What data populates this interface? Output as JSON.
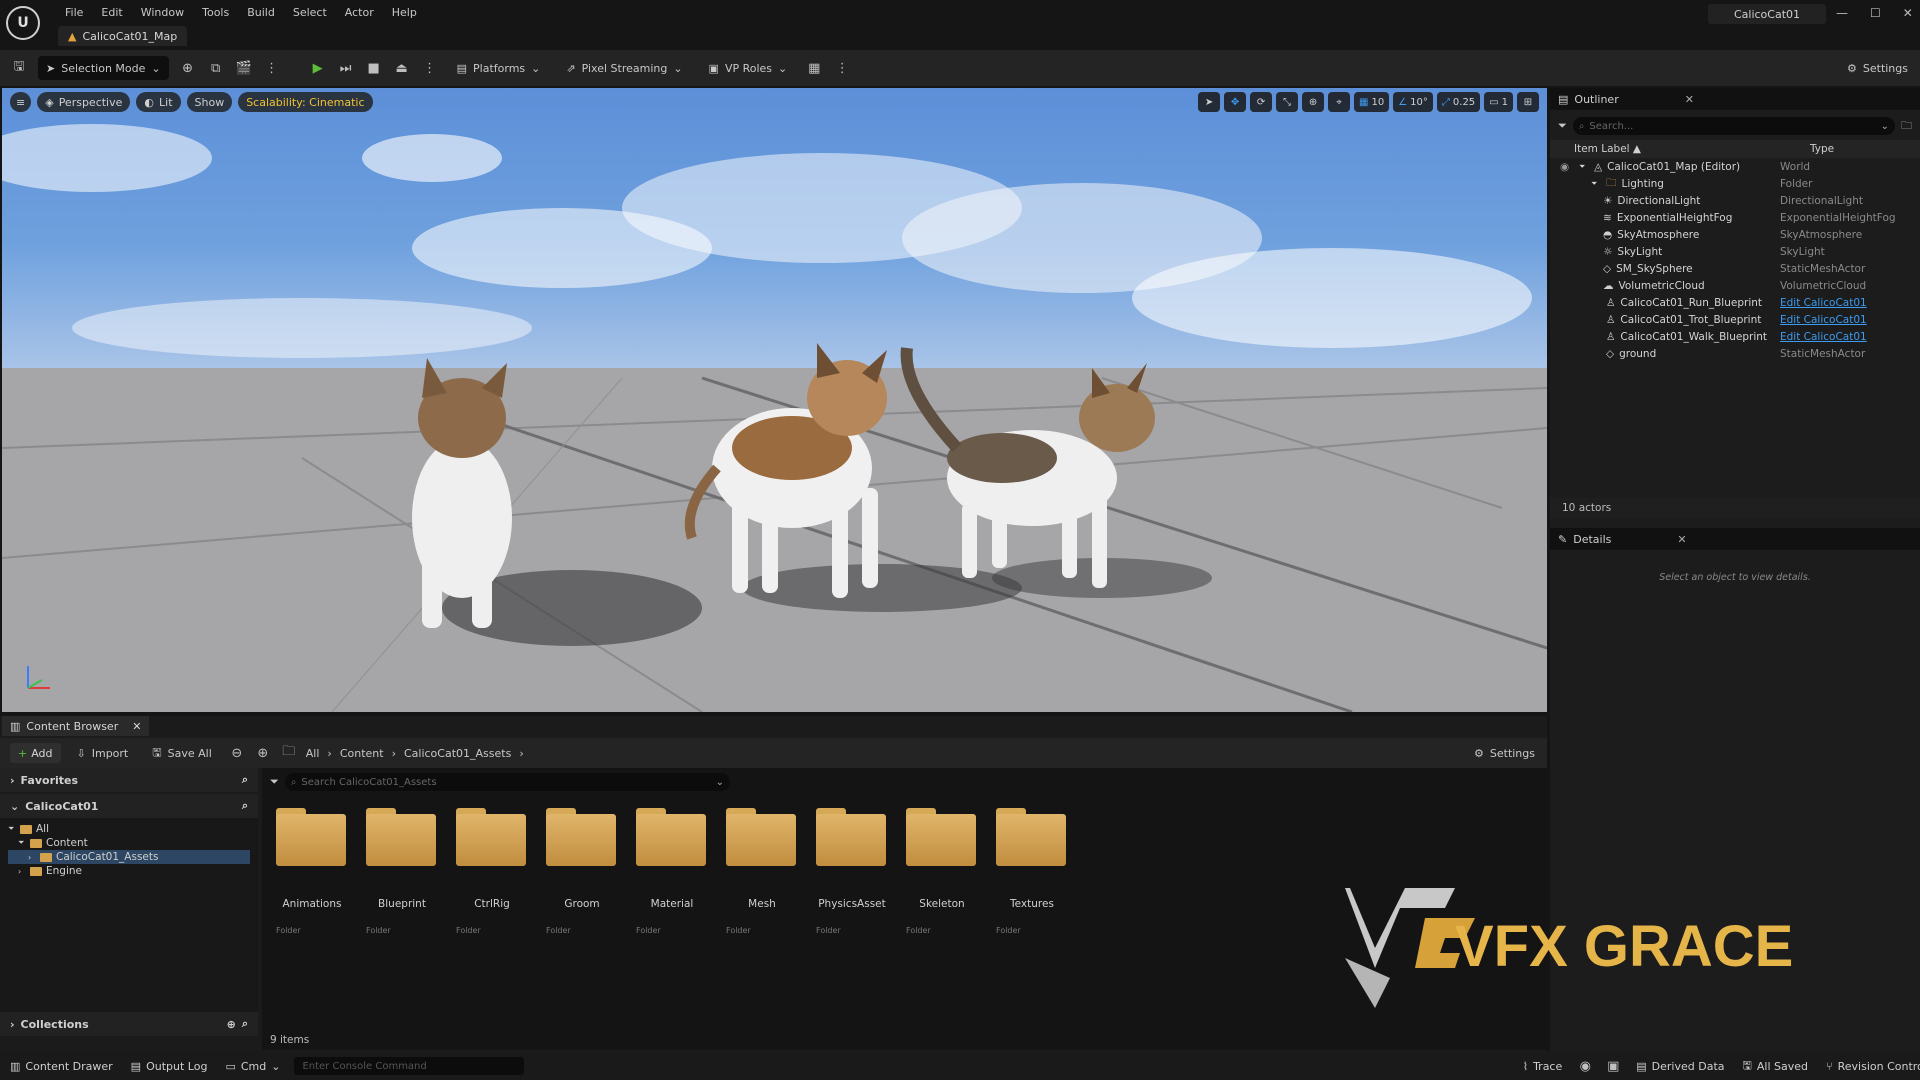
{
  "app": {
    "map_tab": "CalicoCat01_Map",
    "project_name": "CalicoCat01"
  },
  "menu": [
    "File",
    "Edit",
    "Window",
    "Tools",
    "Build",
    "Select",
    "Actor",
    "Help"
  ],
  "toolbar": {
    "selection_mode": "Selection Mode",
    "platforms": "Platforms",
    "pixel_streaming": "Pixel Streaming",
    "vp_roles": "VP Roles",
    "settings": "Settings"
  },
  "viewport": {
    "perspective": "Perspective",
    "lit": "Lit",
    "show": "Show",
    "scalability": "Scalability: Cinematic",
    "grid_snap": "10",
    "rotation_snap": "10°",
    "scale_snap": "0.25",
    "camera_speed": "1"
  },
  "outliner": {
    "title": "Outliner",
    "search_placeholder": "Search...",
    "col_label": "Item Label",
    "col_type": "Type",
    "rows": [
      {
        "label": "CalicoCat01_Map (Editor)",
        "type": "World",
        "indent": 0,
        "icon": "world-icon",
        "link": false
      },
      {
        "label": "Lighting",
        "type": "Folder",
        "indent": 1,
        "icon": "folder-icon",
        "link": false
      },
      {
        "label": "DirectionalLight",
        "type": "DirectionalLight",
        "indent": 2,
        "icon": "light-icon",
        "link": false
      },
      {
        "label": "ExponentialHeightFog",
        "type": "ExponentialHeightFog",
        "indent": 2,
        "icon": "fog-icon",
        "link": false
      },
      {
        "label": "SkyAtmosphere",
        "type": "SkyAtmosphere",
        "indent": 2,
        "icon": "atmosphere-icon",
        "link": false
      },
      {
        "label": "SkyLight",
        "type": "SkyLight",
        "indent": 2,
        "icon": "skylight-icon",
        "link": false
      },
      {
        "label": "SM_SkySphere",
        "type": "StaticMeshActor",
        "indent": 2,
        "icon": "mesh-icon",
        "link": false
      },
      {
        "label": "VolumetricCloud",
        "type": "VolumetricCloud",
        "indent": 2,
        "icon": "cloud-icon",
        "link": false
      },
      {
        "label": "CalicoCat01_Run_Blueprint",
        "type": "Edit CalicoCat01",
        "indent": 1,
        "icon": "blueprint-icon",
        "link": true
      },
      {
        "label": "CalicoCat01_Trot_Blueprint",
        "type": "Edit CalicoCat01",
        "indent": 1,
        "icon": "blueprint-icon",
        "link": true
      },
      {
        "label": "CalicoCat01_Walk_Blueprint",
        "type": "Edit CalicoCat01",
        "indent": 1,
        "icon": "blueprint-icon",
        "link": true
      },
      {
        "label": "ground",
        "type": "StaticMeshActor",
        "indent": 1,
        "icon": "mesh-icon",
        "link": false
      }
    ],
    "actor_count": "10 actors"
  },
  "details": {
    "title": "Details",
    "empty_message": "Select an object to view details."
  },
  "content_browser": {
    "tab": "Content Browser",
    "add": "Add",
    "import": "Import",
    "save_all": "Save All",
    "breadcrumb": [
      "All",
      "Content",
      "CalicoCat01_Assets"
    ],
    "settings": "Settings",
    "favorites": "Favorites",
    "project": "CalicoCat01",
    "tree": [
      {
        "label": "All",
        "indent": 0,
        "selected": false
      },
      {
        "label": "Content",
        "indent": 1,
        "selected": false
      },
      {
        "label": "CalicoCat01_Assets",
        "indent": 2,
        "selected": true
      },
      {
        "label": "Engine",
        "indent": 1,
        "selected": false
      }
    ],
    "collections": "Collections",
    "search_placeholder": "Search CalicoCat01_Assets",
    "folders": [
      {
        "name": "Animations",
        "kind": "Folder"
      },
      {
        "name": "Blueprint",
        "kind": "Folder"
      },
      {
        "name": "CtrlRig",
        "kind": "Folder"
      },
      {
        "name": "Groom",
        "kind": "Folder"
      },
      {
        "name": "Material",
        "kind": "Folder"
      },
      {
        "name": "Mesh",
        "kind": "Folder"
      },
      {
        "name": "PhysicsAsset",
        "kind": "Folder"
      },
      {
        "name": "Skeleton",
        "kind": "Folder"
      },
      {
        "name": "Textures",
        "kind": "Folder"
      }
    ],
    "item_count": "9 items"
  },
  "statusbar": {
    "content_drawer": "Content Drawer",
    "output_log": "Output Log",
    "cmd": "Cmd",
    "console_placeholder": "Enter Console Command",
    "trace": "Trace",
    "derived_data": "Derived Data",
    "all_saved": "All Saved",
    "revision_control": "Revision Control"
  },
  "watermark": {
    "text": "VFX GRACE"
  }
}
